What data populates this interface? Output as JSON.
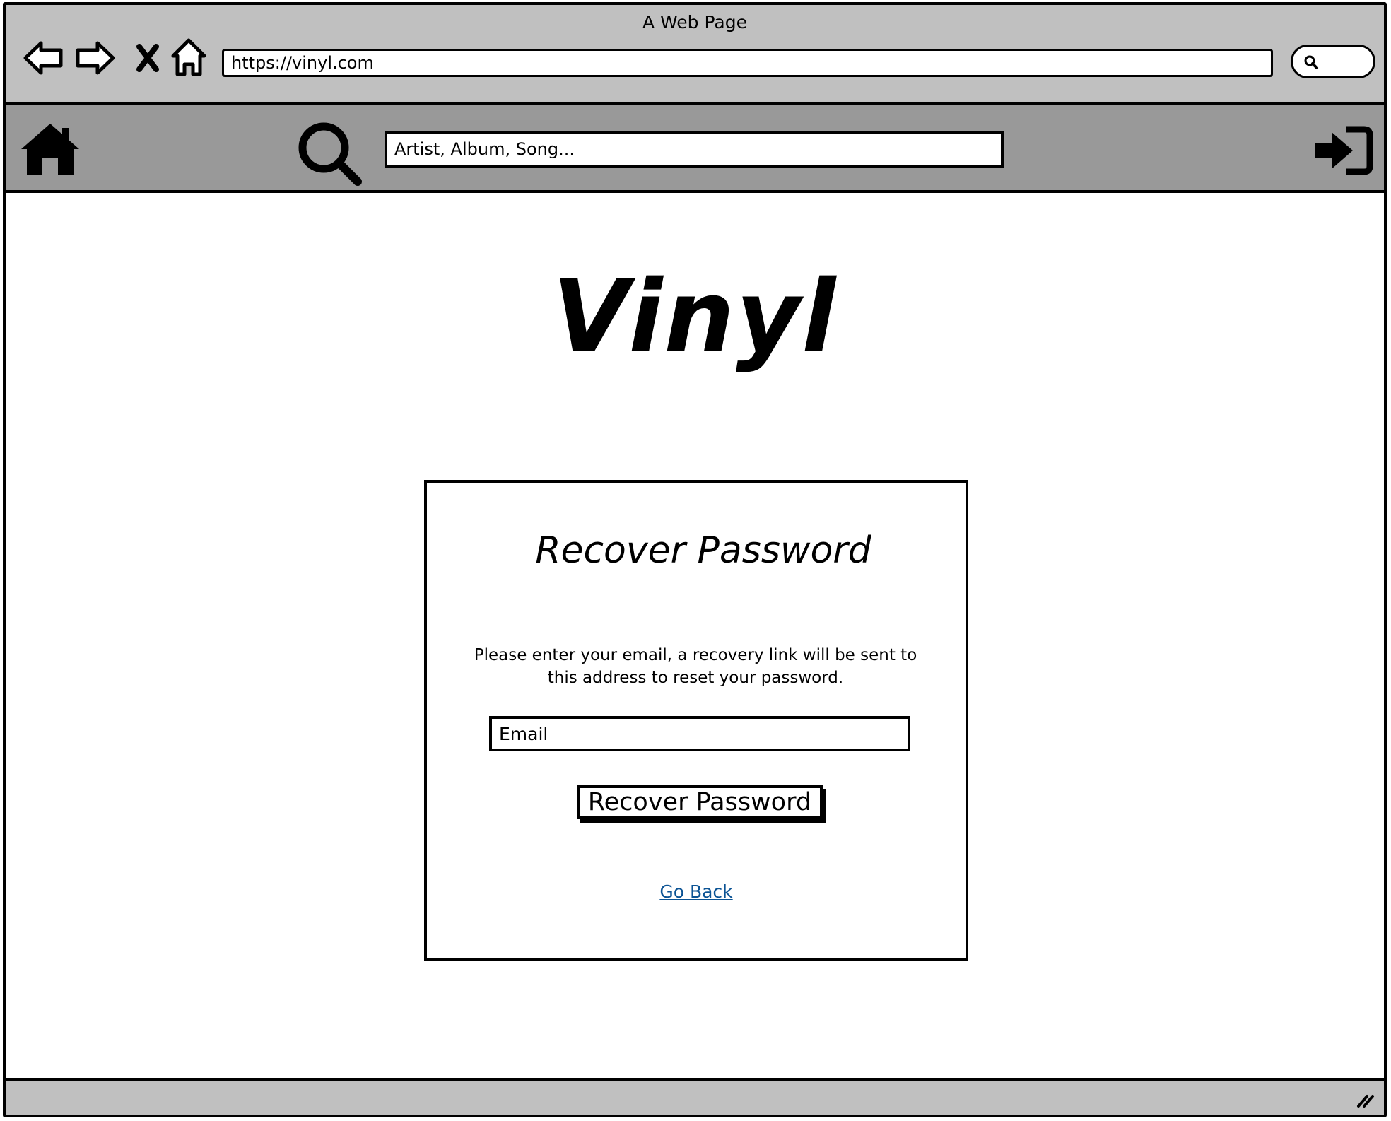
{
  "window": {
    "title": "A Web Page"
  },
  "browser": {
    "url": "https://vinyl.com",
    "icons": [
      "back-icon",
      "forward-icon",
      "stop-icon",
      "home-icon",
      "search-icon"
    ]
  },
  "site_header": {
    "search_placeholder": "Artist, Album, Song...",
    "icons": [
      "home-icon",
      "search-icon",
      "sign-in-icon"
    ]
  },
  "main": {
    "logo": "Vinyl",
    "card": {
      "title": "Recover Password",
      "description": "Please enter your email, a recovery link will be sent to this address to reset your password.",
      "email_placeholder": "Email",
      "submit_label": "Recover Password",
      "back_link": "Go Back"
    }
  },
  "colors": {
    "chrome_bg": "#c0c0c0",
    "header_bg": "#999999",
    "link": "#0b5394",
    "border": "#000000"
  }
}
